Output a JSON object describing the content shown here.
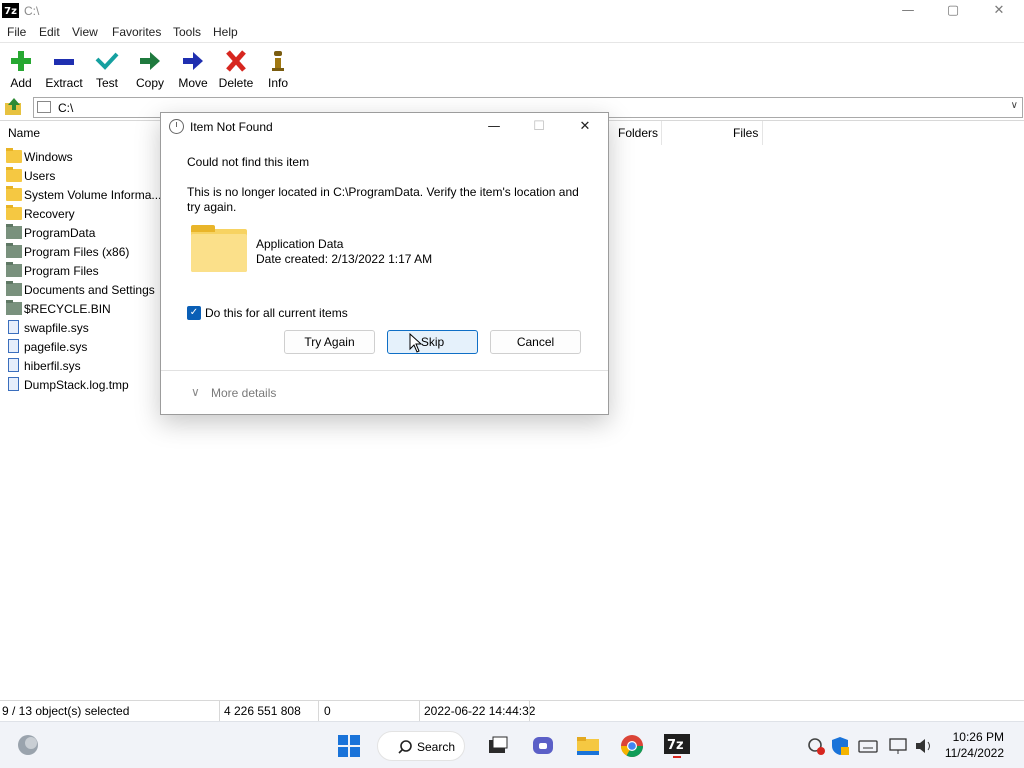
{
  "window": {
    "title": "C:\\",
    "app_icon_text": "7z",
    "controls": {
      "minimize": "—",
      "maximize": "▢",
      "close": "✕"
    }
  },
  "menu": [
    "File",
    "Edit",
    "View",
    "Favorites",
    "Tools",
    "Help"
  ],
  "toolbar": {
    "add": "Add",
    "extract": "Extract",
    "test": "Test",
    "copy": "Copy",
    "move": "Move",
    "delete": "Delete",
    "info": "Info"
  },
  "address": {
    "value": "C:\\"
  },
  "list": {
    "columns": {
      "name": "Name",
      "folders": "Folders",
      "files": "Files"
    },
    "items": [
      {
        "name": "Windows",
        "icon": "folder-yellow"
      },
      {
        "name": "Users",
        "icon": "folder-yellow"
      },
      {
        "name": "System Volume Informa...",
        "icon": "folder-yellow"
      },
      {
        "name": "Recovery",
        "icon": "folder-yellow"
      },
      {
        "name": "ProgramData",
        "icon": "folder-gray"
      },
      {
        "name": "Program Files (x86)",
        "icon": "folder-gray"
      },
      {
        "name": "Program Files",
        "icon": "folder-gray"
      },
      {
        "name": "Documents and Settings",
        "icon": "folder-gray"
      },
      {
        "name": "$RECYCLE.BIN",
        "icon": "folder-gray"
      },
      {
        "name": "swapfile.sys",
        "icon": "file"
      },
      {
        "name": "pagefile.sys",
        "icon": "file"
      },
      {
        "name": "hiberfil.sys",
        "icon": "file"
      },
      {
        "name": "DumpStack.log.tmp",
        "icon": "file"
      }
    ]
  },
  "status": {
    "selected": "9 / 13 object(s) selected",
    "size": "4 226 551 808",
    "count": "0",
    "modified": "2022-06-22 14:44:32"
  },
  "dialog": {
    "title": "Item Not Found",
    "heading": "Could not find this item",
    "message": "This is no longer located in C:\\ProgramData. Verify the item's location and try again.",
    "item_name": "Application Data",
    "item_date": "Date created: 2/13/2022 1:17 AM",
    "checkbox_label": "Do this for all current items",
    "checkbox_checked": true,
    "buttons": {
      "try_again": "Try Again",
      "skip": "Skip",
      "cancel": "Cancel"
    },
    "more_details": "More details",
    "controls": {
      "minimize": "—",
      "maximize": "☐",
      "close": "✕"
    }
  },
  "taskbar": {
    "search_label": "Search",
    "time": "10:26 PM",
    "date": "11/24/2022"
  },
  "colors": {
    "accent": "#0f6fc6",
    "checkbox": "#0a5fb6",
    "add_green": "#27a832",
    "extract_blue": "#1f2fb0",
    "test_teal": "#15a0a0",
    "delete_red": "#d7261f"
  }
}
